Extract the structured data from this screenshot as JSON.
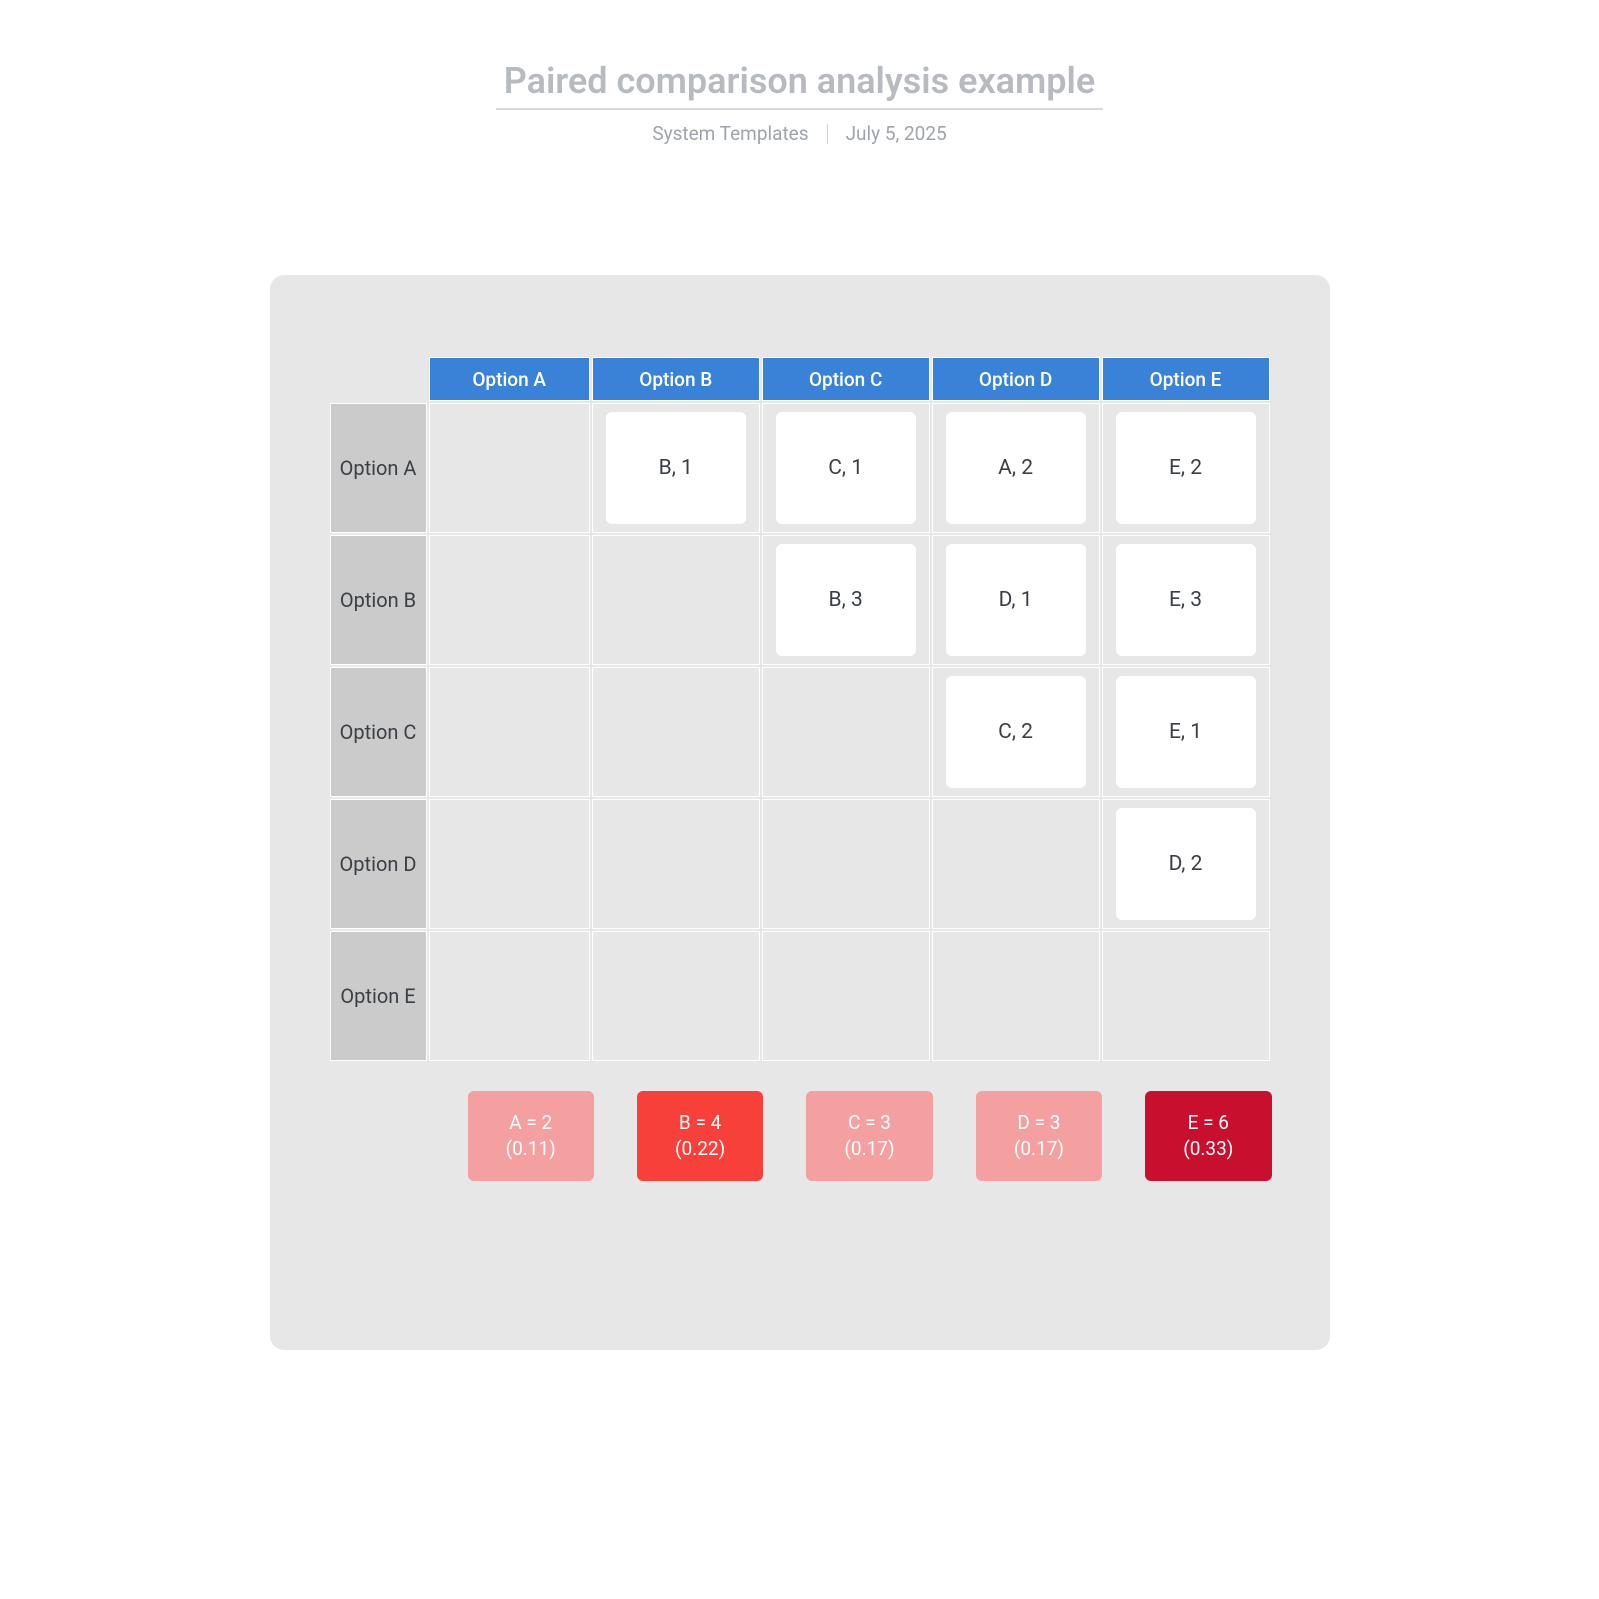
{
  "header": {
    "title": "Paired comparison analysis example",
    "author": "System Templates",
    "date": "July 5, 2025"
  },
  "options": [
    "Option A",
    "Option B",
    "Option C",
    "Option D",
    "Option E"
  ],
  "matrix": [
    [
      null,
      "B, 1",
      "C, 1",
      "A, 2",
      "E, 2"
    ],
    [
      null,
      null,
      "B, 3",
      "D, 1",
      "E, 3"
    ],
    [
      null,
      null,
      null,
      "C, 2",
      "E, 1"
    ],
    [
      null,
      null,
      null,
      null,
      "D, 2"
    ],
    [
      null,
      null,
      null,
      null,
      null
    ]
  ],
  "totals": [
    {
      "label": "A = 2",
      "pct": "(0.11)",
      "color": "#f4a0a1"
    },
    {
      "label": "B = 4",
      "pct": "(0.22)",
      "color": "#f8403a"
    },
    {
      "label": "C = 3",
      "pct": "(0.17)",
      "color": "#f4a0a1"
    },
    {
      "label": "D = 3",
      "pct": "(0.17)",
      "color": "#f4a0a1"
    },
    {
      "label": "E = 6",
      "pct": "(0.33)",
      "color": "#c8102e"
    }
  ]
}
